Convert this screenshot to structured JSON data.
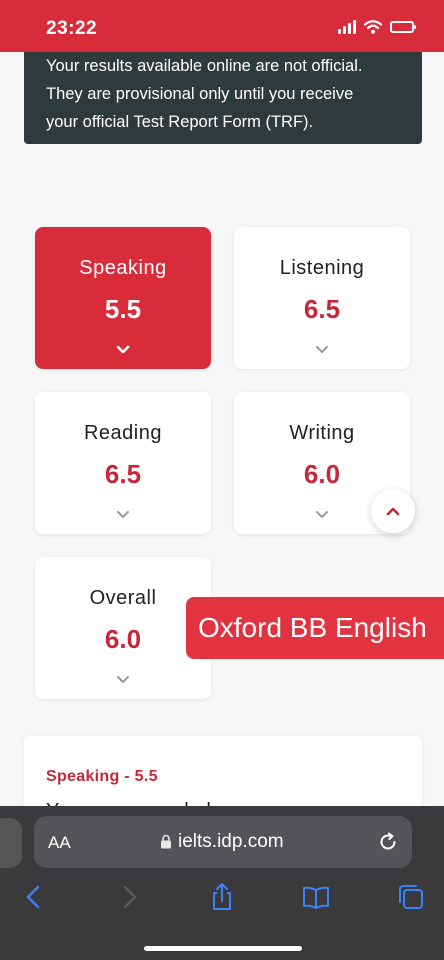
{
  "status_bar": {
    "time": "23:22",
    "icons": [
      "signal-icon",
      "wifi-icon",
      "battery-icon"
    ]
  },
  "notice": {
    "lines": [
      "Your results available online are not official.",
      "They are provisional only until you receive",
      "your official Test Report Form (TRF)."
    ]
  },
  "scores": [
    {
      "label": "Speaking",
      "value": "5.5",
      "active": true
    },
    {
      "label": "Listening",
      "value": "6.5",
      "active": false
    },
    {
      "label": "Reading",
      "value": "6.5",
      "active": false
    },
    {
      "label": "Writing",
      "value": "6.0",
      "active": false
    },
    {
      "label": "Overall",
      "value": "6.0",
      "active": false
    }
  ],
  "watermark": "Oxford BB English",
  "detail": {
    "title": "Speaking - 5.5",
    "body": "You were awarded"
  },
  "browser": {
    "text_size_label": "AA",
    "url": "ielts.idp.com",
    "toolbar": [
      "back-icon",
      "forward-icon",
      "share-icon",
      "bookmarks-icon",
      "tabs-icon"
    ]
  },
  "colors": {
    "accent": "#d82c3b",
    "notice_bg": "#2f3a3d",
    "score": "#c8273a",
    "browser_bg": "#3a3a3c",
    "link_blue": "#3b82f6"
  }
}
